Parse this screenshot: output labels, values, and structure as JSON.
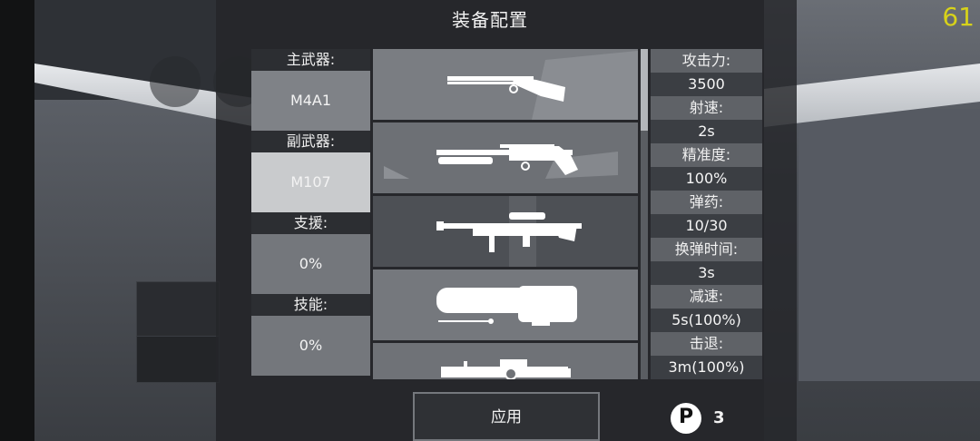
{
  "header": {
    "title": "装备配置",
    "fps": "61"
  },
  "slots": [
    {
      "label": "主武器:",
      "value": "M4A1"
    },
    {
      "label": "副武器:",
      "value": "M107"
    },
    {
      "label": "支援:",
      "value": "0%"
    },
    {
      "label": "技能:",
      "value": "0%"
    }
  ],
  "weapons": [
    {
      "icon": "double-barrel-shotgun-icon"
    },
    {
      "icon": "pump-shotgun-icon"
    },
    {
      "icon": "sniper-rifle-icon"
    },
    {
      "icon": "plasma-cannon-icon"
    },
    {
      "icon": "heavy-launcher-icon"
    }
  ],
  "stats": [
    {
      "label": "攻击力:",
      "value": "3500"
    },
    {
      "label": "射速:",
      "value": "2s"
    },
    {
      "label": "精准度:",
      "value": "100%"
    },
    {
      "label": "弹药:",
      "value": "10/30"
    },
    {
      "label": "换弹时间:",
      "value": "3s"
    },
    {
      "label": "减速:",
      "value": "5s(100%)"
    },
    {
      "label": "击退:",
      "value": "3m(100%)"
    }
  ],
  "footer": {
    "apply_label": "应用",
    "points_icon_letter": "P",
    "points_value": "3"
  },
  "colors": {
    "fps": "#d7d21a",
    "panel": "#24262a",
    "selected_slot": "#c9cbcd"
  }
}
